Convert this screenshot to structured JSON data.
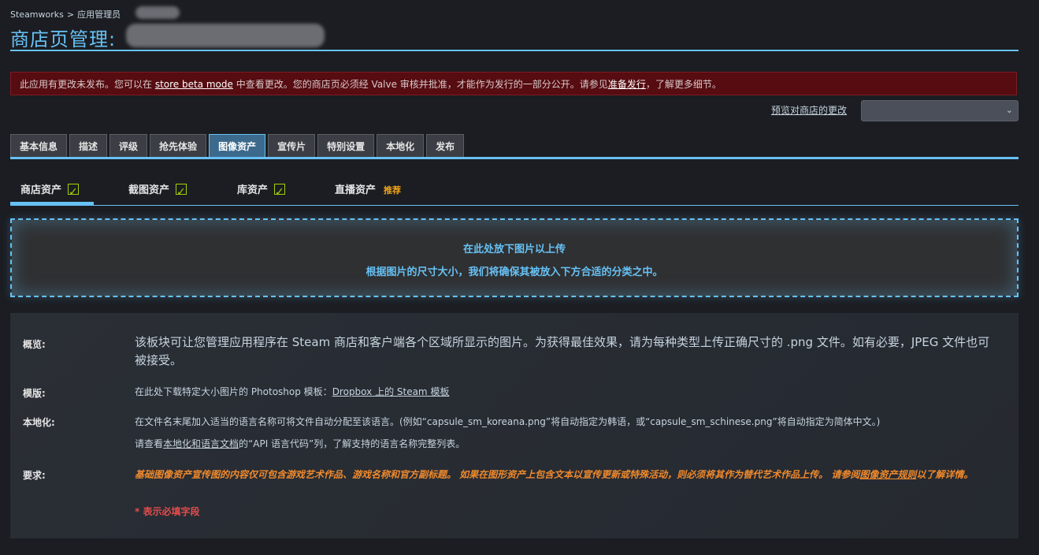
{
  "breadcrumb": {
    "root": "Steamworks",
    "separator": ">",
    "section": "应用管理员"
  },
  "page": {
    "title": "商店页管理:"
  },
  "warning": {
    "text_before": "此应用有更改未发布。您可以在 ",
    "link1": "store beta mode",
    "text_middle": " 中查看更改。您的商店页必须经 Valve 审核并批准，才能作为发行的一部分公开。请参见",
    "link2": "准备发行",
    "text_after": "，了解更多细节。"
  },
  "preview": {
    "link_label": "预览对商店的更改",
    "select_value": ""
  },
  "tabs": [
    {
      "label": "基本信息"
    },
    {
      "label": "描述"
    },
    {
      "label": "评级"
    },
    {
      "label": "抢先体验"
    },
    {
      "label": "图像资产"
    },
    {
      "label": "宣传片"
    },
    {
      "label": "特别设置"
    },
    {
      "label": "本地化"
    },
    {
      "label": "发布"
    }
  ],
  "active_tab": "图像资产",
  "subtabs": [
    {
      "label": "商店资产",
      "icon": "checkbox-checked-icon"
    },
    {
      "label": "截图资产",
      "icon": "checkbox-checked-icon"
    },
    {
      "label": "库资产",
      "icon": "checkbox-checked-icon"
    },
    {
      "label": "直播资产",
      "badge": "推荐"
    }
  ],
  "dropzone": {
    "line1": "在此处放下图片以上传",
    "line2": "根据图片的尺寸大小，我们将确保其被放入下方合适的分类之中。"
  },
  "info": {
    "overview": {
      "label": "概览:",
      "text": "该板块可让您管理应用程序在 Steam 商店和客户端各个区域所显示的图片。为获得最佳效果，请为每种类型上传正确尺寸的 .png 文件。如有必要，JPEG 文件也可被接受。"
    },
    "template": {
      "label": "模版:",
      "text": "在此处下载特定大小图片的 Photoshop 模板：",
      "link": "Dropbox 上的 Steam 模板"
    },
    "localization": {
      "label": "本地化:",
      "text1": "在文件名末尾加入适当的语言名称可将文件自动分配至该语言。(例如“capsule_sm_koreana.png”将自动指定为韩语，或“capsule_sm_schinese.png”将自动指定为简体中文。)",
      "text2_before": "请查看",
      "text2_link": "本地化和语言文档",
      "text2_after": "的“API 语言代码”列，了解支持的语言名称完整列表。"
    },
    "requirements": {
      "label": "要求:",
      "text_before": "基础图像资产宣传图的内容仅可包含游戏艺术作品、游戏名称和官方副标题。 如果在图形资产上包含文本以宣传更新或特殊活动，则必须将其作为替代艺术作品上传。 请参阅",
      "link": "图像资产规则",
      "text_after": "以了解详情。"
    },
    "required_note": "* 表示必填字段"
  },
  "colors": {
    "accent": "#67c1f5",
    "warning_bg": "#560c11",
    "check": "#a4d007",
    "recommend": "#f0a419",
    "requirement_text": "#f08a2c",
    "required": "#e44b4b"
  }
}
